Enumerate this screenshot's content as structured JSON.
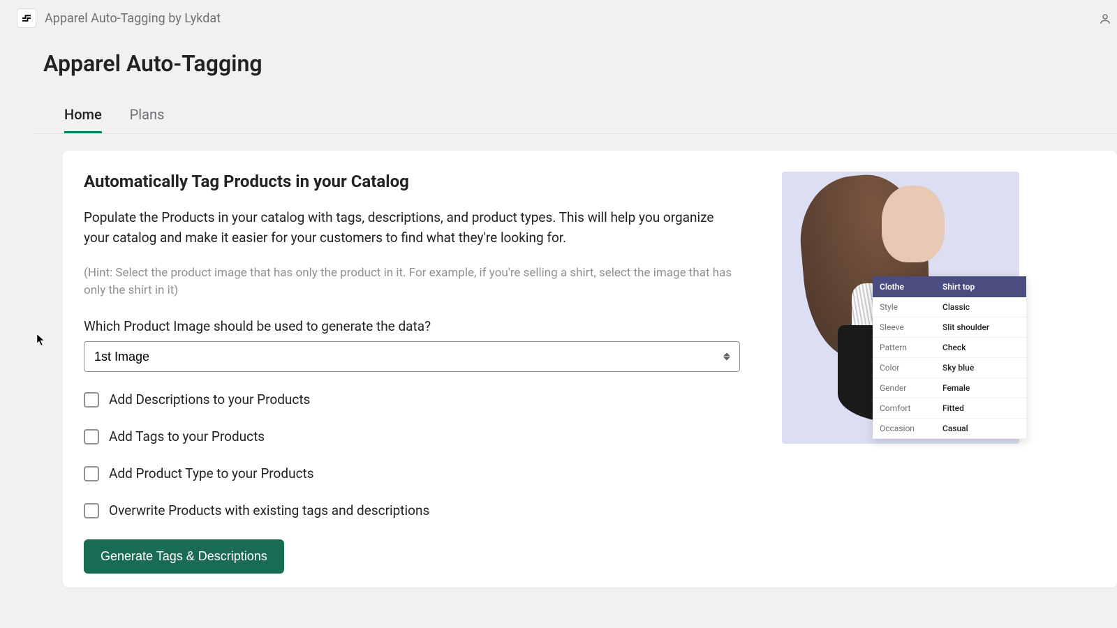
{
  "header": {
    "app_title": "Apparel Auto-Tagging by Lykdat"
  },
  "page": {
    "title": "Apparel Auto-Tagging"
  },
  "tabs": [
    {
      "label": "Home",
      "active": true
    },
    {
      "label": "Plans",
      "active": false
    }
  ],
  "main": {
    "heading": "Automatically Tag Products in your Catalog",
    "description": "Populate the Products in your catalog with tags, descriptions, and product types. This will help you organize your catalog and make it easier for your customers to find what they're looking for.",
    "hint": "(Hint: Select the product image that has only the product in it. For example, if you're selling a shirt, select the image that has only the shirt in it)",
    "select_label": "Which Product Image should be used to generate the data?",
    "select_value": "1st Image",
    "checkboxes": [
      {
        "label": "Add Descriptions to your Products"
      },
      {
        "label": "Add Tags to your Products"
      },
      {
        "label": "Add Product Type to your Products"
      },
      {
        "label": "Overwrite Products with existing tags and descriptions"
      }
    ],
    "button_label": "Generate Tags & Descriptions"
  },
  "preview": {
    "table_header_left": "Clothe",
    "table_header_right": "Shirt top",
    "attributes": [
      {
        "key": "Style",
        "value": "Classic"
      },
      {
        "key": "Sleeve",
        "value": "Slit shoulder"
      },
      {
        "key": "Pattern",
        "value": "Check"
      },
      {
        "key": "Color",
        "value": "Sky blue"
      },
      {
        "key": "Gender",
        "value": "Female"
      },
      {
        "key": "Comfort",
        "value": "Fitted"
      },
      {
        "key": "Occasion",
        "value": "Casual"
      }
    ]
  }
}
